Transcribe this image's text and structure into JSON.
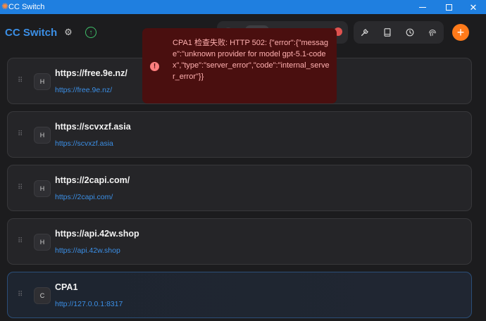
{
  "window": {
    "title": "CC Switch"
  },
  "header": {
    "brand": "CC Switch"
  },
  "providers": [
    {
      "initial": "H",
      "name": "https://free.9e.nz/",
      "url": "https://free.9e.nz/"
    },
    {
      "initial": "H",
      "name": "https://scvxzf.asia",
      "url": "https://scvxzf.asia"
    },
    {
      "initial": "H",
      "name": "https://2capi.com/",
      "url": "https://2capi.com/"
    },
    {
      "initial": "H",
      "name": "https://api.42w.shop",
      "url": "https://api.42w.shop"
    },
    {
      "initial": "C",
      "name": "CPA1",
      "url": "http://127.0.0.1:8317"
    }
  ],
  "toast": {
    "message": "CPA1 检查失败: HTTP 502: {\"error\":{\"message\":\"unknown provider for model gpt-5.1-codex\",\"type\":\"server_error\",\"code\":\"internal_server_error\"}}"
  },
  "colors": {
    "accent": "#3b8fe6",
    "add_button": "#ff7a1a",
    "toast_bg": "#4a0f0f",
    "titlebar": "#1f7fe0"
  }
}
